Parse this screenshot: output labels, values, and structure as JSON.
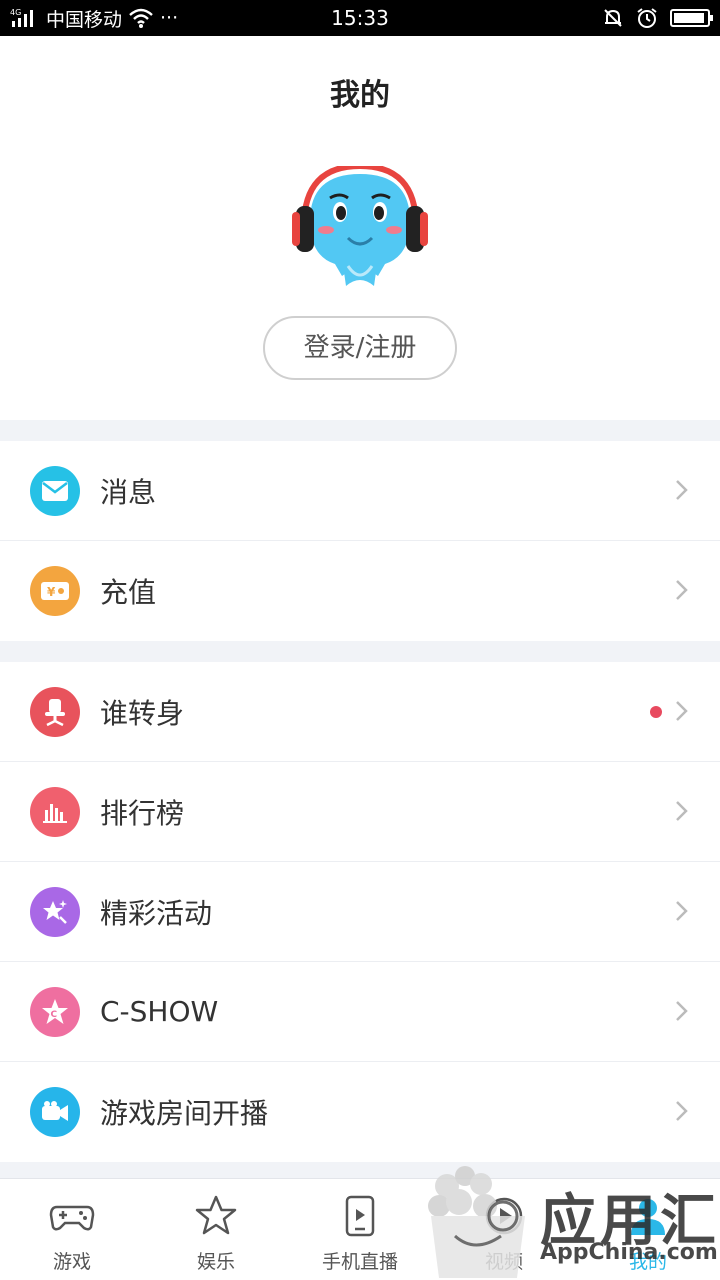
{
  "status_bar": {
    "network": "4G",
    "carrier": "中国移动",
    "more": "···",
    "time": "15:33"
  },
  "header": {
    "title": "我的",
    "login_label": "登录/注册"
  },
  "menu": {
    "group1": [
      {
        "label": "消息",
        "icon": "mail-icon",
        "color": "#26c1e6"
      },
      {
        "label": "充值",
        "icon": "wallet-icon",
        "color": "#f3a53f"
      }
    ],
    "group2": [
      {
        "label": "谁转身",
        "icon": "chair-icon",
        "color": "#e8535c",
        "badge": true
      },
      {
        "label": "排行榜",
        "icon": "bars-icon",
        "color": "#f0606e"
      },
      {
        "label": "精彩活动",
        "icon": "star-sparkle-icon",
        "color": "#a968e6"
      },
      {
        "label": "C-SHOW",
        "icon": "star-c-icon",
        "color": "#ef6fa0"
      },
      {
        "label": "游戏房间开播",
        "icon": "video-camera-icon",
        "color": "#26b5ea"
      }
    ]
  },
  "tabbar": [
    {
      "label": "游戏",
      "icon": "gamepad-icon"
    },
    {
      "label": "娱乐",
      "icon": "star-icon"
    },
    {
      "label": "手机直播",
      "icon": "phone-play-icon"
    },
    {
      "label": "视频",
      "icon": "video-icon"
    },
    {
      "label": "我的",
      "icon": "profile-icon",
      "active": true
    }
  ],
  "watermark": {
    "big": "应用汇",
    "small": "AppChina.com"
  },
  "colors": {
    "accent": "#2bb8e8",
    "badge": "#e84a5f"
  }
}
